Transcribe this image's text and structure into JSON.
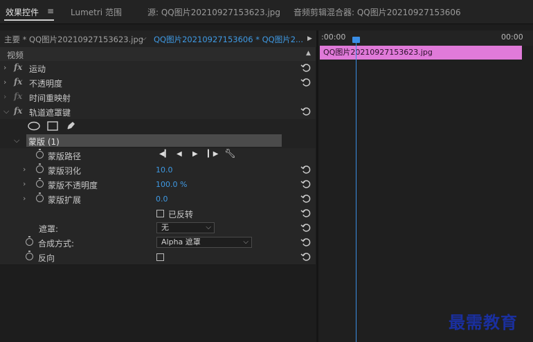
{
  "tabs": [
    {
      "label": "效果控件",
      "active": true
    },
    {
      "label": "Lumetri 范围",
      "active": false
    },
    {
      "label": "源: QQ图片20210927153623.jpg",
      "active": false
    },
    {
      "label": "音频剪辑混合器: QQ图片20210927153606",
      "active": false
    }
  ],
  "tab_menu_icon": "hamburger-icon",
  "source": {
    "master_label": "主要 * QQ图片20210927153623.jpg",
    "sequence_label": "QQ图片20210927153606 * QQ图片2...",
    "play_icon": "play-icon"
  },
  "timeline": {
    "start_time": ":00:00",
    "end_time": "00:00",
    "clip_label": "QQ图片20210927153623.jpg",
    "clip_color": "#e07ad9",
    "playhead_color": "#3a8ee6"
  },
  "section": {
    "label": "视频"
  },
  "effects": [
    {
      "name": "运动"
    },
    {
      "name": "不透明度"
    },
    {
      "name": "时间重映射"
    },
    {
      "name": "轨道遮罩键"
    }
  ],
  "mask": {
    "label": "蒙版 (1)",
    "path_label": "蒙版路径",
    "feather_label": "蒙版羽化",
    "feather_value": "10.0",
    "opacity_label": "蒙版不透明度",
    "opacity_value": "100.0 %",
    "expansion_label": "蒙版扩展",
    "expansion_value": "0.0",
    "inverted_label": "已反转"
  },
  "matte": {
    "label": "遮罩:",
    "value": "无"
  },
  "composite": {
    "label": "合成方式:",
    "value": "Alpha 遮罩"
  },
  "reverse": {
    "label": "反向"
  },
  "watermark": "最需教育",
  "accent_color": "#3f9ae4"
}
